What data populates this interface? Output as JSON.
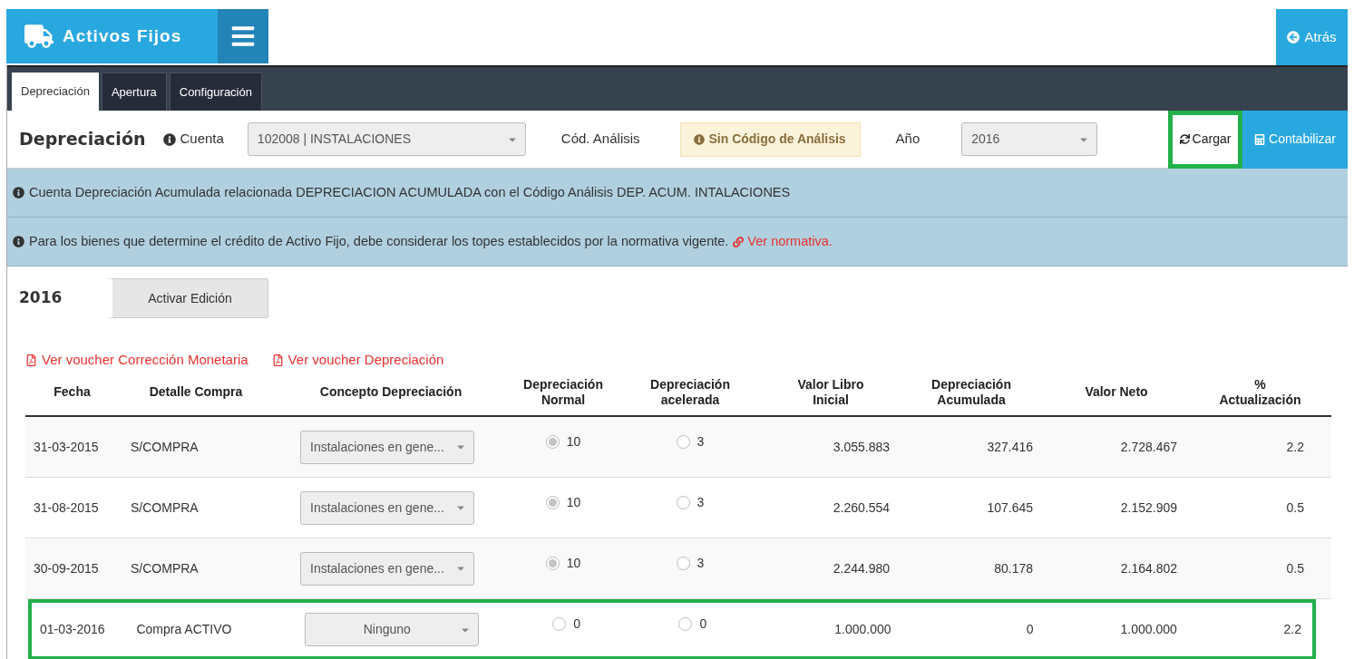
{
  "header": {
    "title": "Activos Fijos",
    "back_button": "Atrás"
  },
  "tabs": [
    {
      "label": "Depreciación",
      "selected": true
    },
    {
      "label": "Apertura",
      "selected": false
    },
    {
      "label": "Configuración",
      "selected": false
    }
  ],
  "toolbar": {
    "title": "Depreciación",
    "account_label": "Cuenta",
    "account_value": "102008 | INSTALACIONES",
    "analysis_label": "Cód. Análisis",
    "analysis_badge": "Sin Código de Análisis",
    "year_label": "Año",
    "year_value": "2016",
    "load_button": {
      "label": "Cargar",
      "highlighted": true
    },
    "post_button": "Contabilizar"
  },
  "alerts": [
    {
      "text": "Cuenta Depreciación Acumulada relacionada DEPRECIACION ACUMULADA con el Código Análisis DEP. ACUM. INTALACIONES"
    },
    {
      "text": "Para los bienes que determine el crédito de Activo Fijo, debe considerar los topes establecidos por la normativa vigente.",
      "link": "Ver normativa."
    }
  ],
  "section": {
    "year": "2016",
    "edit_toggle": {
      "label": "Activar Edición",
      "on": false
    }
  },
  "voucher_links": [
    "Ver voucher Corrección Monetaria",
    "Ver voucher Depreciación"
  ],
  "table": {
    "columns": [
      "Fecha",
      "Detalle Compra",
      "Concepto Depreciación",
      "Depreciación\nNormal",
      "Depreciación\nacelerada",
      "Valor Libro\nInicial",
      "Depreciación\nAcumulada",
      "Valor Neto",
      "%\nActualización"
    ],
    "rows": [
      {
        "date": "31-03-2015",
        "detail": "S/COMPRA",
        "concept": "Instalaciones en gene...",
        "normal": {
          "value": "10",
          "checked": true
        },
        "accelerated": {
          "value": "3",
          "checked": false
        },
        "initial_value": "3.055.883",
        "accumulated": "327.416",
        "net": "2.728.467",
        "update_pct": "2.2",
        "highlighted": false
      },
      {
        "date": "31-08-2015",
        "detail": "S/COMPRA",
        "concept": "Instalaciones en gene...",
        "normal": {
          "value": "10",
          "checked": true
        },
        "accelerated": {
          "value": "3",
          "checked": false
        },
        "initial_value": "2.260.554",
        "accumulated": "107.645",
        "net": "2.152.909",
        "update_pct": "0.5",
        "highlighted": false
      },
      {
        "date": "30-09-2015",
        "detail": "S/COMPRA",
        "concept": "Instalaciones en gene...",
        "normal": {
          "value": "10",
          "checked": true
        },
        "accelerated": {
          "value": "3",
          "checked": false
        },
        "initial_value": "2.244.980",
        "accumulated": "80.178",
        "net": "2.164.802",
        "update_pct": "0.5",
        "highlighted": false
      },
      {
        "date": "01-03-2016",
        "detail": "Compra ACTIVO",
        "concept": "Ninguno",
        "normal": {
          "value": "0",
          "checked": false
        },
        "accelerated": {
          "value": "0",
          "checked": false
        },
        "initial_value": "1.000.000",
        "accumulated": "0",
        "net": "1.000.000",
        "update_pct": "2.2",
        "highlighted": true
      }
    ]
  }
}
